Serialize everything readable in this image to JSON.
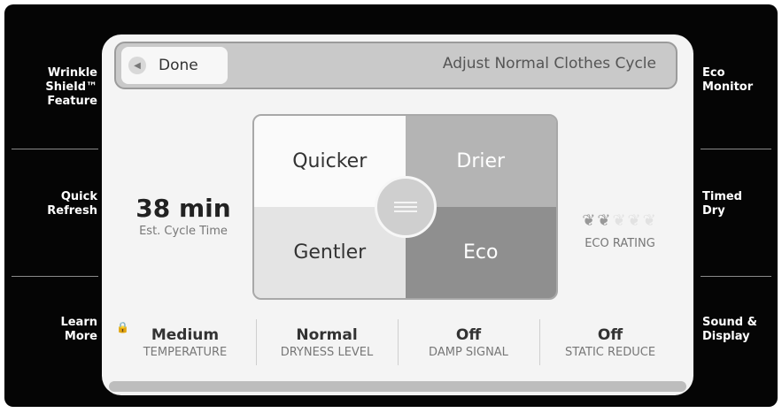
{
  "left_buttons": [
    {
      "label": "Wrinkle\nShield™\nFeature"
    },
    {
      "label": "Quick\nRefresh"
    },
    {
      "label": "Learn\nMore"
    }
  ],
  "right_buttons": [
    {
      "label": "Eco\nMonitor"
    },
    {
      "label": "Timed\nDry"
    },
    {
      "label": "Sound &\nDisplay"
    }
  ],
  "header": {
    "done_label": "Done",
    "back_icon": "left-arrow-icon",
    "title": "Adjust Normal Clothes Cycle"
  },
  "cycle": {
    "time": "38 min",
    "caption": "Est. Cycle Time"
  },
  "selector": {
    "top_left": "Quicker",
    "top_right": "Drier",
    "bottom_left": "Gentler",
    "bottom_right": "Eco"
  },
  "eco_rating": {
    "caption": "ECO RATING",
    "leaves_filled": 2,
    "leaves_total": 5
  },
  "settings": [
    {
      "value": "Medium",
      "label": "TEMPERATURE",
      "locked": true
    },
    {
      "value": "Normal",
      "label": "DRYNESS LEVEL"
    },
    {
      "value": "Off",
      "label": "DAMP SIGNAL"
    },
    {
      "value": "Off",
      "label": "STATIC REDUCE"
    }
  ],
  "colors": {
    "frame": "#050505",
    "screen": "#f4f4f4",
    "titlebar": "#c9c9c9"
  }
}
